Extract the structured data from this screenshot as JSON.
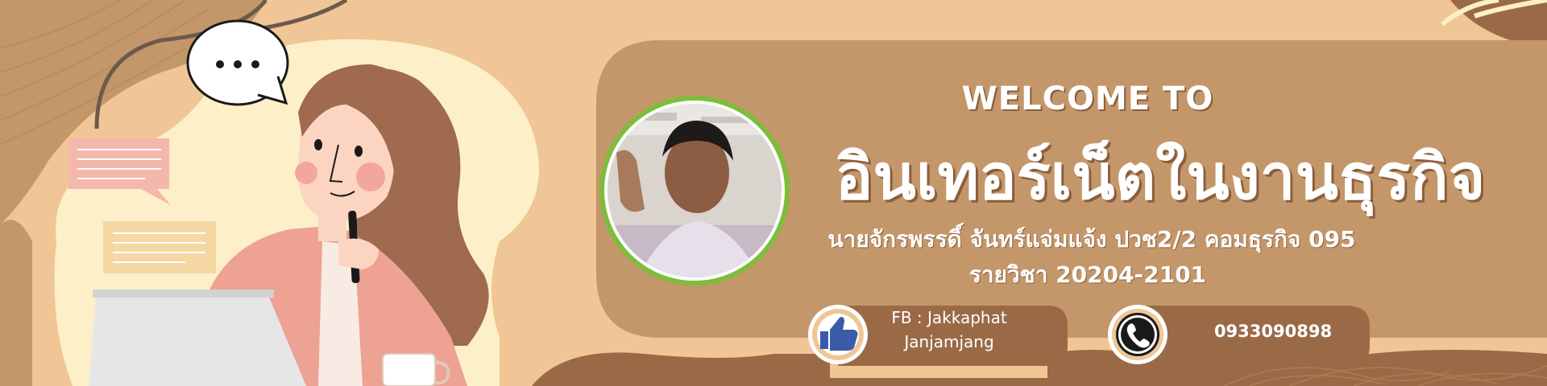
{
  "banner": {
    "welcome": "WELCOME TO",
    "course_title": "อินเทอร์เน็ตในงานธุรกิจ",
    "student_line": "นายจักรพรรดิ์ จันทร์แจ่มแจ้ง ปวช2/2 คอมธุรกิจ 095",
    "subject_line": "รายวิชา 20204-2101"
  },
  "contacts": {
    "facebook": {
      "label_line1": "FB : Jakkaphat",
      "label_line2": "Janjamjang",
      "icon": "thumbs-up-icon"
    },
    "phone": {
      "number": "0933090898",
      "icon": "phone-icon"
    }
  },
  "colors": {
    "background": "#f0c696",
    "panel": "#c4976a",
    "dark_brown": "#9a6a47",
    "cream": "#fdefc7",
    "text": "#ffffff"
  }
}
